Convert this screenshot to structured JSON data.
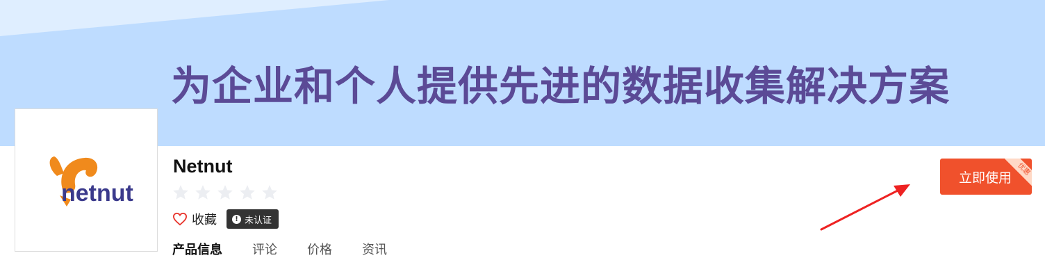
{
  "banner": {
    "headline": "为企业和个人提供先进的数据收集解决方案",
    "background_color": "#bedcff",
    "headline_color": "#5b4a96"
  },
  "product": {
    "logo_text": "netnut",
    "name": "Netnut",
    "rating": 0,
    "rating_max": 5,
    "favorite_label": "收藏",
    "verification_badge": "未认证",
    "verification_badge_icon": "!"
  },
  "tabs": [
    {
      "label": "产品信息",
      "active": true
    },
    {
      "label": "评论",
      "active": false
    },
    {
      "label": "价格",
      "active": false
    },
    {
      "label": "资讯",
      "active": false
    }
  ],
  "cta": {
    "label": "立即使用",
    "ribbon": "优惠",
    "color": "#f0512c"
  },
  "annotation": {
    "arrow_color": "#ee2222"
  }
}
